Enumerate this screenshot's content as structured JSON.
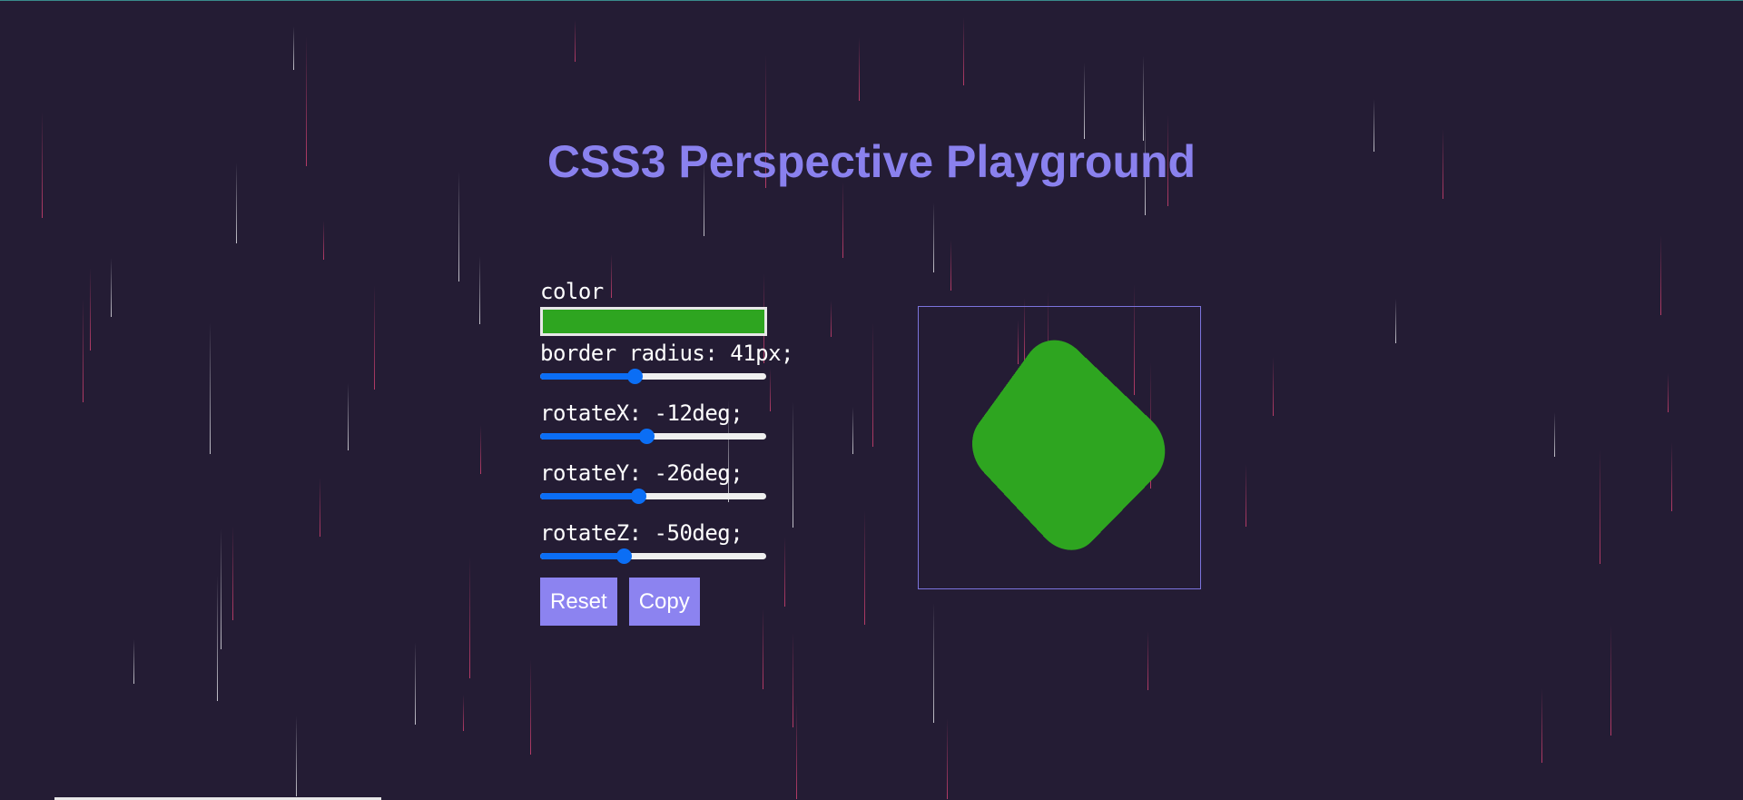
{
  "page": {
    "title": "CSS3 Perspective Playground"
  },
  "controls": {
    "color": {
      "label": "color",
      "value": "#2ea520"
    },
    "border_radius": {
      "label": "border radius: 41px;",
      "value": 41,
      "min": 0,
      "max": 100
    },
    "rotate_x": {
      "label": "rotateX: -12deg;",
      "value": -12,
      "min": -180,
      "max": 180
    },
    "rotate_y": {
      "label": "rotateY: -26deg;",
      "value": -26,
      "min": -180,
      "max": 180
    },
    "rotate_z": {
      "label": "rotateZ: -50deg;",
      "value": -50,
      "min": -180,
      "max": 180
    }
  },
  "buttons": {
    "reset_label": "Reset",
    "copy_label": "Copy"
  },
  "colors": {
    "background": "#241c34",
    "accent": "#8a81ee",
    "shape": "#2ea520",
    "slider": "#0b6ef5"
  }
}
